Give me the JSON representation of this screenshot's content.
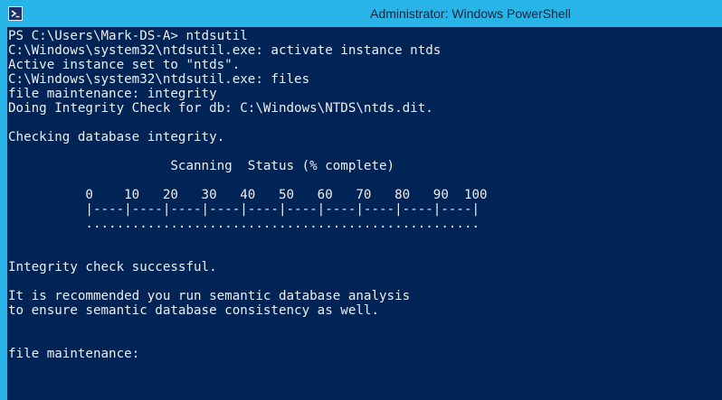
{
  "window": {
    "title": "Administrator: Windows PowerShell",
    "icon": "powershell-icon",
    "colors": {
      "title_bar": "#29b4e8",
      "console_background": "#012456",
      "console_text": "#eeedf0"
    }
  },
  "console": {
    "lines": [
      "PS C:\\Users\\Mark-DS-A> ntdsutil",
      "C:\\Windows\\system32\\ntdsutil.exe: activate instance ntds",
      "Active instance set to \"ntds\".",
      "C:\\Windows\\system32\\ntdsutil.exe: files",
      "file maintenance: integrity",
      "Doing Integrity Check for db: C:\\Windows\\NTDS\\ntds.dit.",
      "",
      "Checking database integrity.",
      "",
      "                     Scanning  Status (% complete)",
      "",
      "          0    10   20   30   40   50   60   70   80   90  100",
      "          |----|----|----|----|----|----|----|----|----|----|",
      "          ...................................................",
      "",
      "",
      "Integrity check successful.",
      "",
      "It is recommended you run semantic database analysis",
      "to ensure semantic database consistency as well.",
      "",
      "",
      "file maintenance: "
    ]
  }
}
